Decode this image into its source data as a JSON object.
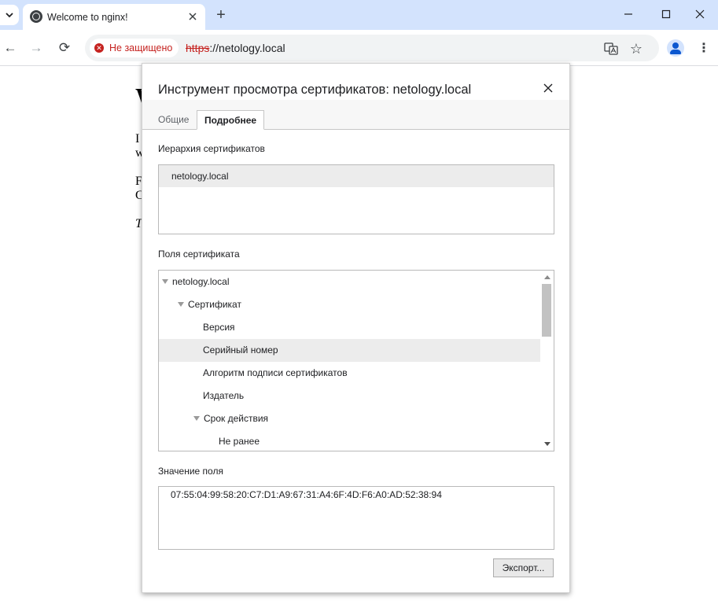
{
  "browser": {
    "tab_title": "Welcome to nginx!",
    "new_tab_symbol": "+",
    "security_label": "Не защищено",
    "url_scheme": "https",
    "url_rest": "://netology.local",
    "window_controls": [
      "minimize-icon",
      "maximize-icon",
      "close-icon"
    ],
    "icons": {
      "back": "←",
      "forward": "→",
      "reload": "⟳",
      "translate": "translate-icon",
      "bookmark": "☆",
      "menu": "⋮"
    }
  },
  "page": {
    "heading_fragment": "W",
    "line_fragments": [
      "I",
      "w",
      "F",
      "C",
      "T"
    ]
  },
  "dialog": {
    "title": "Инструмент просмотра сертификатов: netology.local",
    "tabs": [
      "Общие",
      "Подробнее"
    ],
    "active_tab": "Подробнее",
    "hierarchy_label": "Иерархия сертификатов",
    "hierarchy_items": [
      "netology.local"
    ],
    "fields_label": "Поля сертификата",
    "fields": [
      {
        "label": "netology.local",
        "level": 0,
        "expanded": true
      },
      {
        "label": "Сертификат",
        "level": 1,
        "expanded": true
      },
      {
        "label": "Версия",
        "level": 2
      },
      {
        "label": "Серийный номер",
        "level": 2,
        "selected": true
      },
      {
        "label": "Алгоритм подписи сертификатов",
        "level": 2
      },
      {
        "label": "Издатель",
        "level": 2
      },
      {
        "label": "Срок действия",
        "level": 2,
        "expanded": true
      },
      {
        "label": "Не ранее",
        "level": 3
      }
    ],
    "value_label": "Значение поля",
    "field_value": "07:55:04:99:58:20:C7:D1:A9:67:31:A4:6F:4D:F6:A0:AD:52:38:94",
    "export_button": "Экспорт..."
  },
  "colors": {
    "tabstrip_bg": "#d3e3fd",
    "insecure_red": "#c5221f",
    "selected_row": "#ececec"
  }
}
